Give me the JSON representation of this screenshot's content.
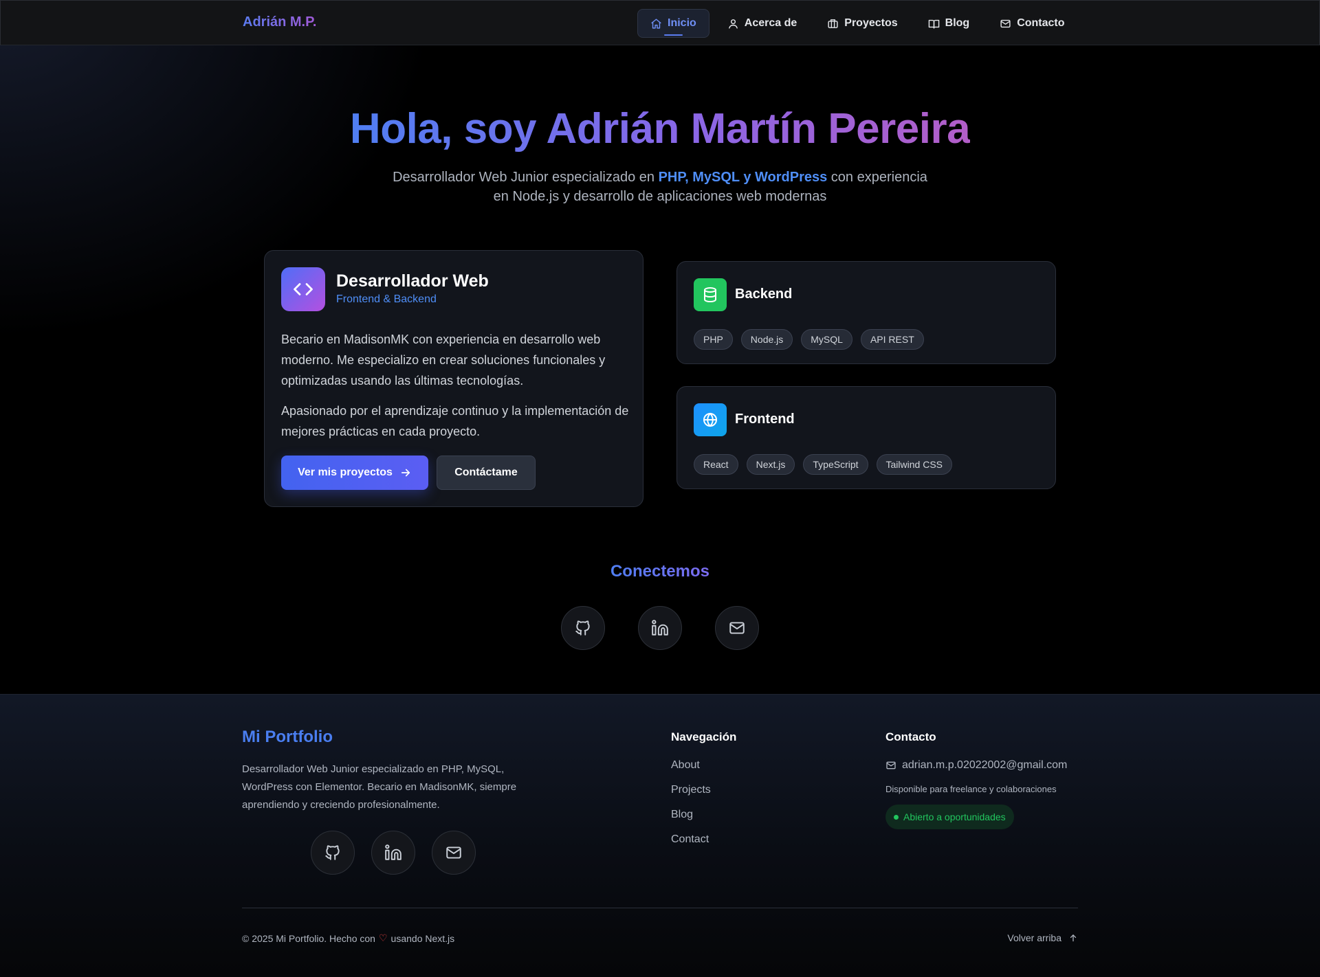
{
  "nav": {
    "brand": "Adrián M.P.",
    "items": [
      {
        "label": "Inicio",
        "icon": "home-icon",
        "active": true
      },
      {
        "label": "Acerca de",
        "icon": "user-icon",
        "active": false
      },
      {
        "label": "Proyectos",
        "icon": "briefcase-icon",
        "active": false
      },
      {
        "label": "Blog",
        "icon": "book-icon",
        "active": false
      },
      {
        "label": "Contacto",
        "icon": "mail-icon",
        "active": false
      }
    ]
  },
  "hero": {
    "title": "Hola, soy Adrián Martín Pereira",
    "subtitle_pre": "Desarrollador Web Junior especializado en ",
    "subtitle_highlight": "PHP, MySQL y WordPress",
    "subtitle_post": " con experiencia en Node.js y desarrollo de aplicaciones web modernas"
  },
  "main_card": {
    "icon": "code-icon",
    "title": "Desarrollador Web",
    "tag": "Frontend & Backend",
    "paragraph1": "Becario en MadisonMK con experiencia en desarrollo web moderno. Me especializo en crear soluciones funcionales y optimizadas usando las últimas tecnologías.",
    "paragraph2": "Apasionado por el aprendizaje continuo y la implementación de mejores prácticas en cada proyecto.",
    "primary_button": "Ver mis proyectos",
    "secondary_button": "Contáctame"
  },
  "skills": {
    "backend": {
      "title": "Backend",
      "icon": "database-icon",
      "pills": [
        "PHP",
        "Node.js",
        "MySQL",
        "API REST"
      ]
    },
    "frontend": {
      "title": "Frontend",
      "icon": "globe-icon",
      "pills": [
        "React",
        "Next.js",
        "TypeScript",
        "Tailwind CSS"
      ]
    }
  },
  "connect": {
    "title": "Conectemos",
    "socials": [
      "github-icon",
      "linkedin-icon",
      "mail-icon"
    ]
  },
  "footer": {
    "brand": "Mi Portfolio",
    "description": "Desarrollador Web Junior especializado en PHP, MySQL, WordPress con Elementor. Becario en MadisonMK, siempre aprendiendo y creciendo profesionalmente.",
    "nav_title": "Navegación",
    "nav_links": [
      "About",
      "Projects",
      "Blog",
      "Contact"
    ],
    "contact_title": "Contacto",
    "email": "adrian.m.p.02022002@gmail.com",
    "availability": "Disponible para freelance y colaboraciones",
    "status": "Abierto a oportunidades",
    "copyright_pre": "© 2025 Mi Portfolio. Hecho con",
    "copyright_post": "usando Next.js",
    "back_to_top": "Volver arriba"
  },
  "colors": {
    "accent": "#4f8ef7",
    "brand_gradient_start": "#4f7ef2",
    "brand_gradient_end": "#b35ec8",
    "success": "#22c55e"
  }
}
